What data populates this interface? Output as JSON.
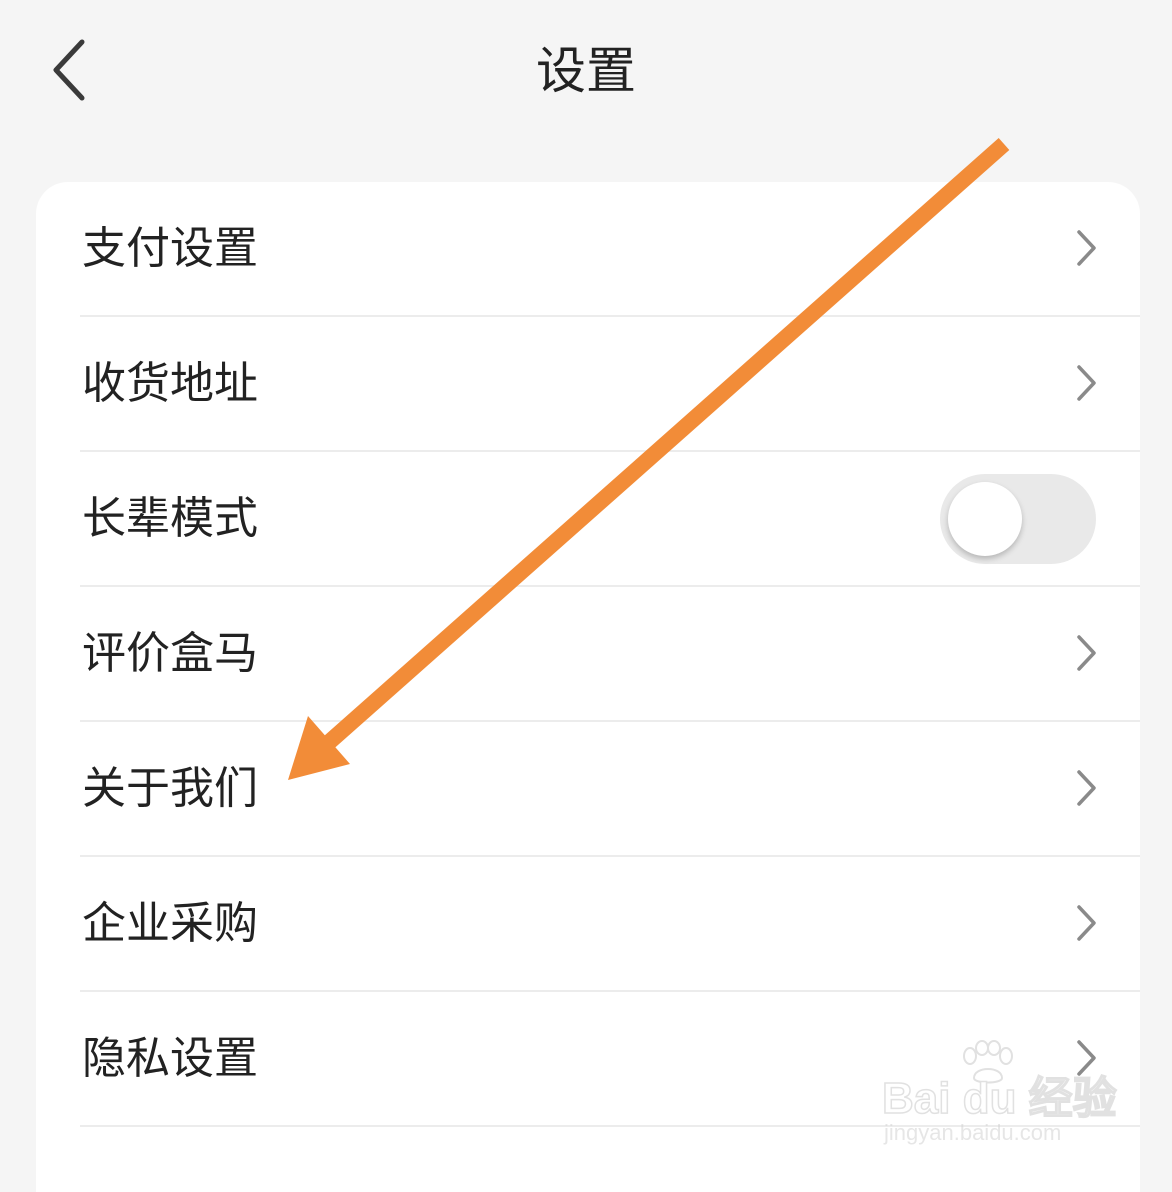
{
  "header": {
    "title": "设置",
    "back_icon": "chevron-left-icon"
  },
  "settings": {
    "items": [
      {
        "label": "支付设置",
        "control": "chevron"
      },
      {
        "label": "收货地址",
        "control": "chevron"
      },
      {
        "label": "长辈模式",
        "control": "toggle",
        "toggle_on": false
      },
      {
        "label": "评价盒马",
        "control": "chevron"
      },
      {
        "label": "关于我们",
        "control": "chevron"
      },
      {
        "label": "企业采购",
        "control": "chevron"
      },
      {
        "label": "隐私设置",
        "control": "chevron"
      }
    ]
  },
  "annotation": {
    "arrow_color": "#f28c38",
    "arrow_target": "关于我们"
  },
  "watermark": {
    "brand": "Bai du 经验",
    "site": "jingyan.baidu.com"
  },
  "colors": {
    "background": "#f5f5f5",
    "card": "#ffffff",
    "text": "#222222",
    "chevron": "#8a8a8a",
    "toggle_track": "#e9e9e9"
  }
}
